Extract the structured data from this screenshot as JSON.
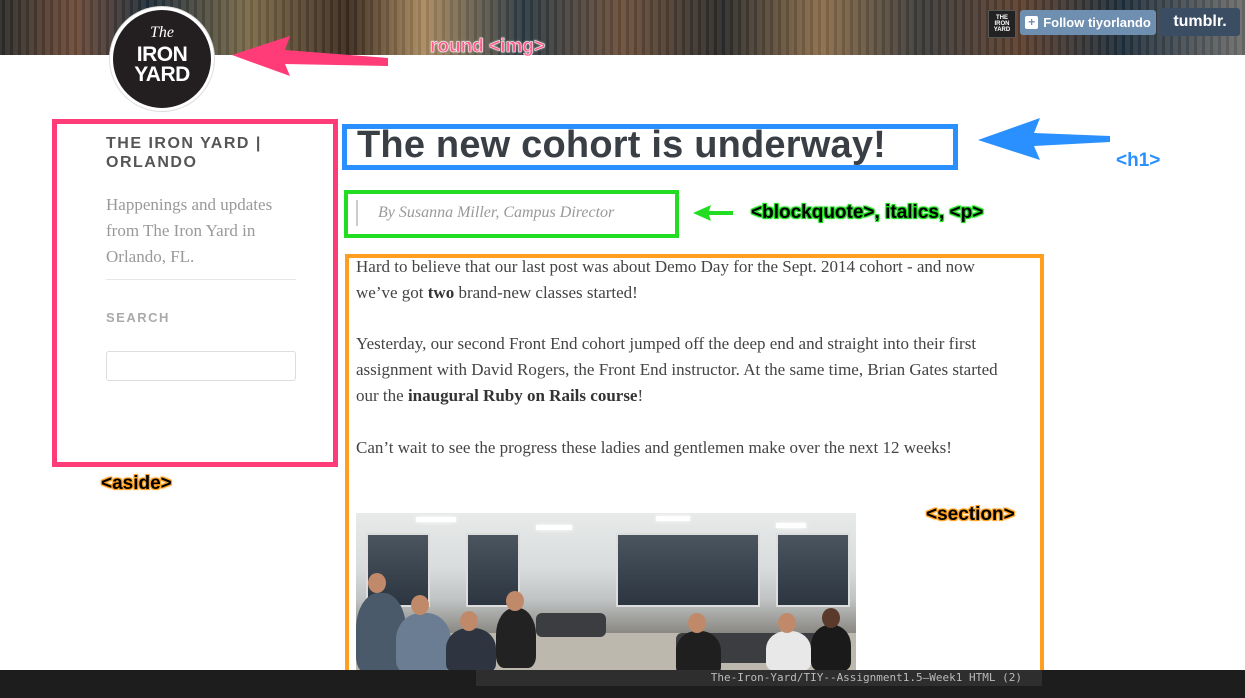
{
  "header": {
    "follow_label": "Follow tiyorlando",
    "follow_plus": "+",
    "tumblr_logo": "tumblr.",
    "avatar_text": "THE IRON YARD"
  },
  "logo": {
    "line1": "The",
    "line2": "IRON",
    "line3": "YARD"
  },
  "sidebar": {
    "title": "THE IRON YARD | ORLANDO",
    "description": "Happenings and updates from The Iron Yard in Orlando, FL.",
    "search_label": "SEARCH",
    "search_value": ""
  },
  "post": {
    "title": "The new cohort is underway!",
    "byline": "By Susanna Miller, Campus Director",
    "p1_a": "Hard to believe that our last post was about Demo Day for the Sept. 2014 cohort - and now we’ve got ",
    "p1_bold": "two",
    "p1_b": " brand-new classes started!",
    "p2_a": "Yesterday, our second Front End cohort jumped off the deep end and straight into their first assignment with David Rogers, the Front End instructor. At the same time, Brian Gates started our the ",
    "p2_bold": "inaugural Ruby on Rails course",
    "p2_b": "!",
    "p3": "Can’t wait to see the progress these ladies and gentlemen make over the next 12 weeks!"
  },
  "annotations": {
    "img": "round <img>",
    "h1": "<h1>",
    "blockquote": "<blockquote>, italics, <p>",
    "aside": "<aside>",
    "section": "<section>"
  },
  "statusbar": {
    "text": "The-Iron-Yard/TIY--Assignment1.5—Week1 HTML (2)"
  },
  "colors": {
    "pink": "#ff3c78",
    "blue": "#2a8fff",
    "green": "#22dd22",
    "orange": "#ff9e20"
  }
}
